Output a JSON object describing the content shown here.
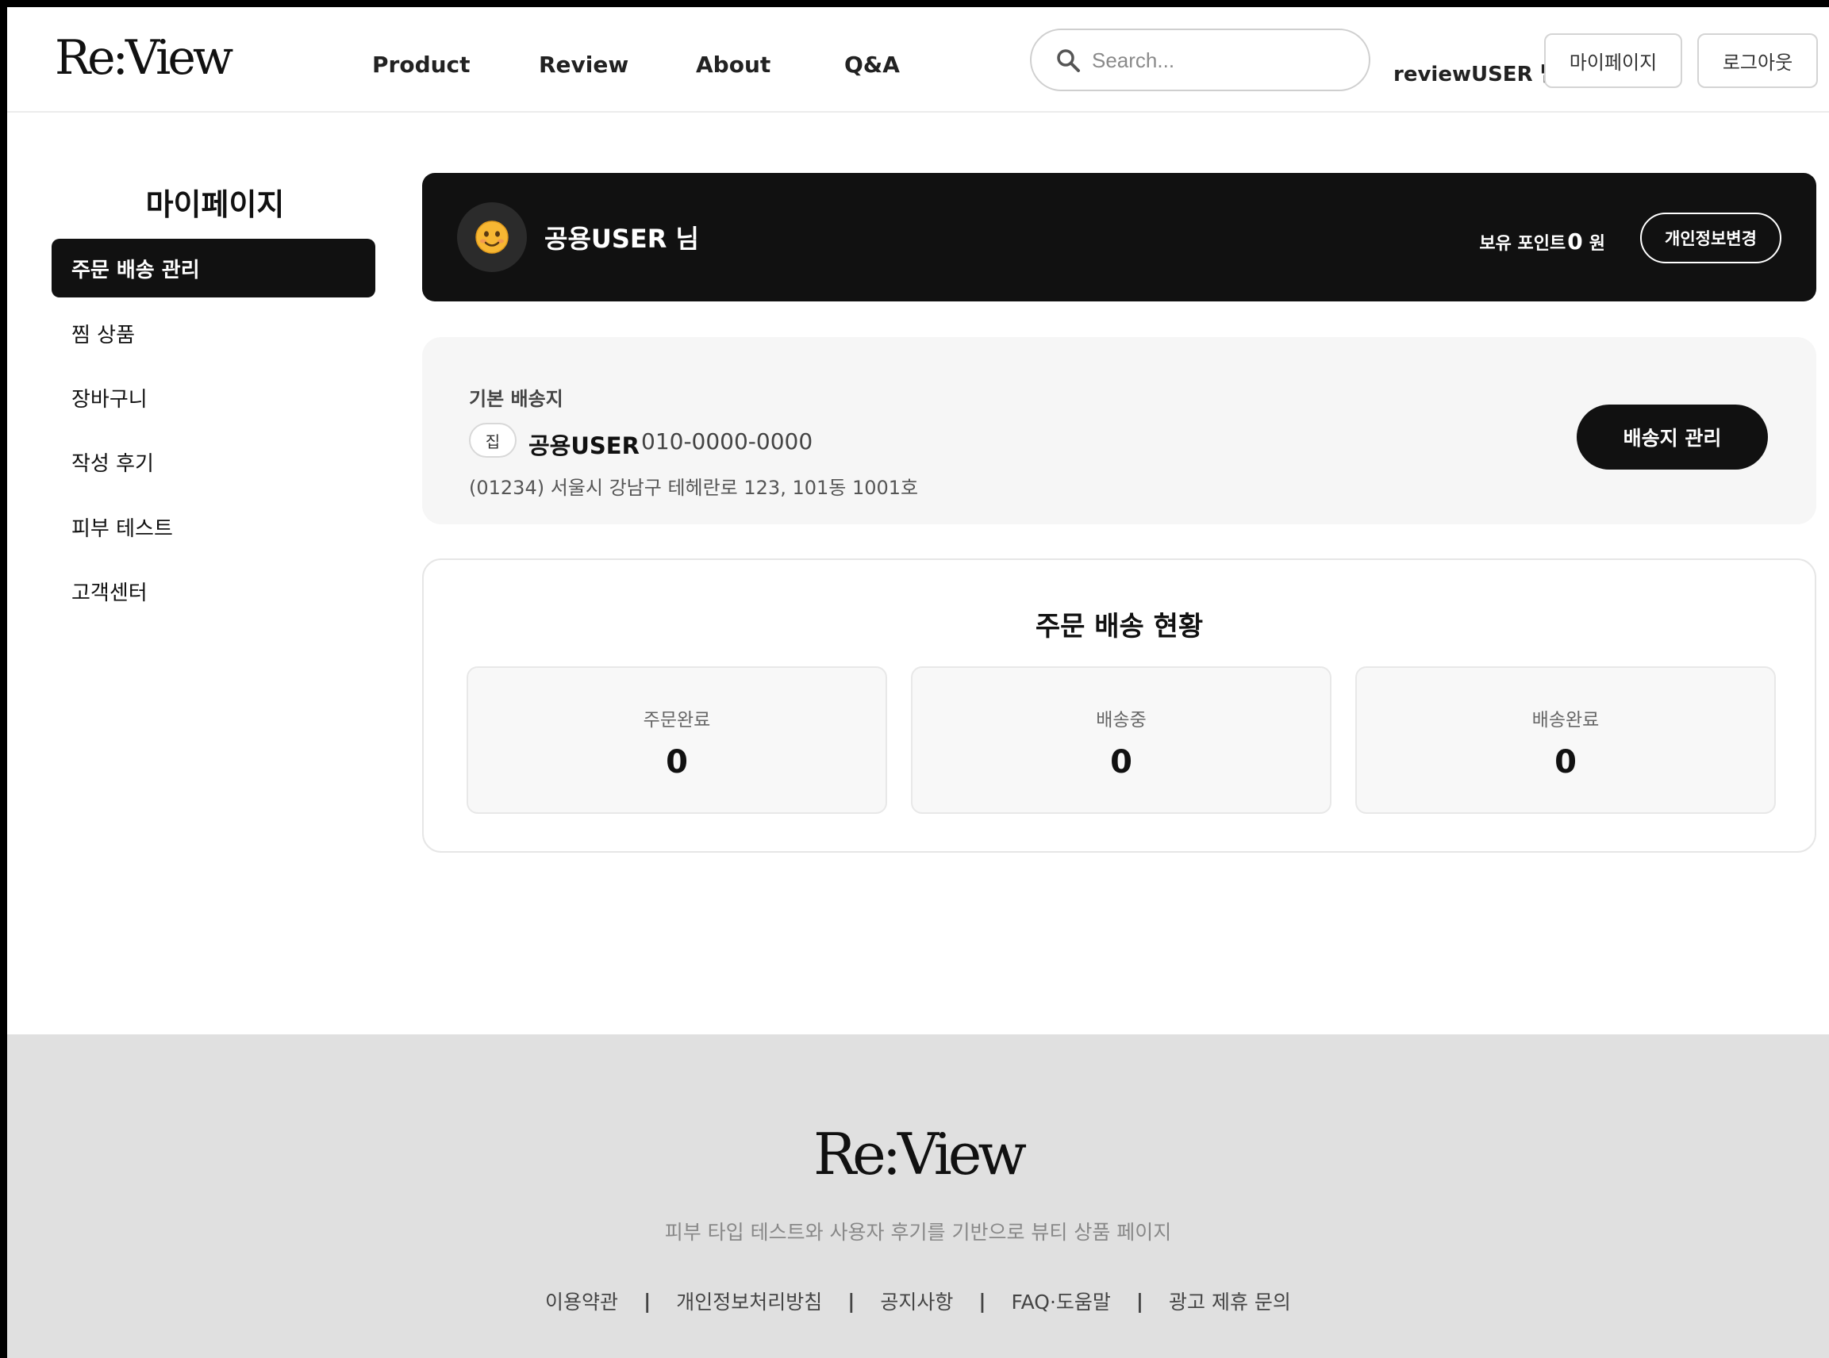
{
  "brand": {
    "logo": "Re:View"
  },
  "nav": {
    "items": [
      {
        "label": "Product"
      },
      {
        "label": "Review"
      },
      {
        "label": "About"
      },
      {
        "label": "Q&A"
      }
    ]
  },
  "search": {
    "placeholder": "Search..."
  },
  "header_user": {
    "greeting": "reviewUSER 님",
    "mypage_label": "마이페이지",
    "logout_label": "로그아웃"
  },
  "sidebar": {
    "title": "마이페이지",
    "items": [
      {
        "label": "주문 배송 관리",
        "active": true
      },
      {
        "label": "찜 상품"
      },
      {
        "label": "장바구니"
      },
      {
        "label": "작성 후기"
      },
      {
        "label": "피부 테스트"
      },
      {
        "label": "고객센터"
      }
    ]
  },
  "profile": {
    "name": "공용USER 님",
    "points_label": "보유 포인트",
    "points_value": "0",
    "points_unit": "원",
    "edit_label": "개인정보변경"
  },
  "address": {
    "label": "기본 배송지",
    "tag": "집",
    "name": "공용USER",
    "phone": "010-0000-0000",
    "line": "(01234) 서울시 강남구 테헤란로 123, 101동 1001호",
    "manage_label": "배송지 관리"
  },
  "order_status": {
    "title": "주문 배송 현황",
    "items": [
      {
        "label": "주문완료",
        "value": "0"
      },
      {
        "label": "배송중",
        "value": "0"
      },
      {
        "label": "배송완료",
        "value": "0"
      }
    ]
  },
  "footer": {
    "logo": "Re:View",
    "description": "피부 타입 테스트와 사용자 후기를 기반으로 뷰티 상품 페이지",
    "separator": "|",
    "links": [
      {
        "label": "이용약관"
      },
      {
        "label": "개인정보처리방침"
      },
      {
        "label": "공지사항"
      },
      {
        "label": "FAQ·도움말"
      },
      {
        "label": "광고 제휴 문의"
      }
    ]
  },
  "colors": {
    "primary": "#111111",
    "background": "#ffffff",
    "card": "#f6f6f6",
    "footer": "#e0e0e0",
    "muted_text": "#888888"
  },
  "icons": {
    "search": "search-icon",
    "avatar": "smiling-face-icon"
  }
}
